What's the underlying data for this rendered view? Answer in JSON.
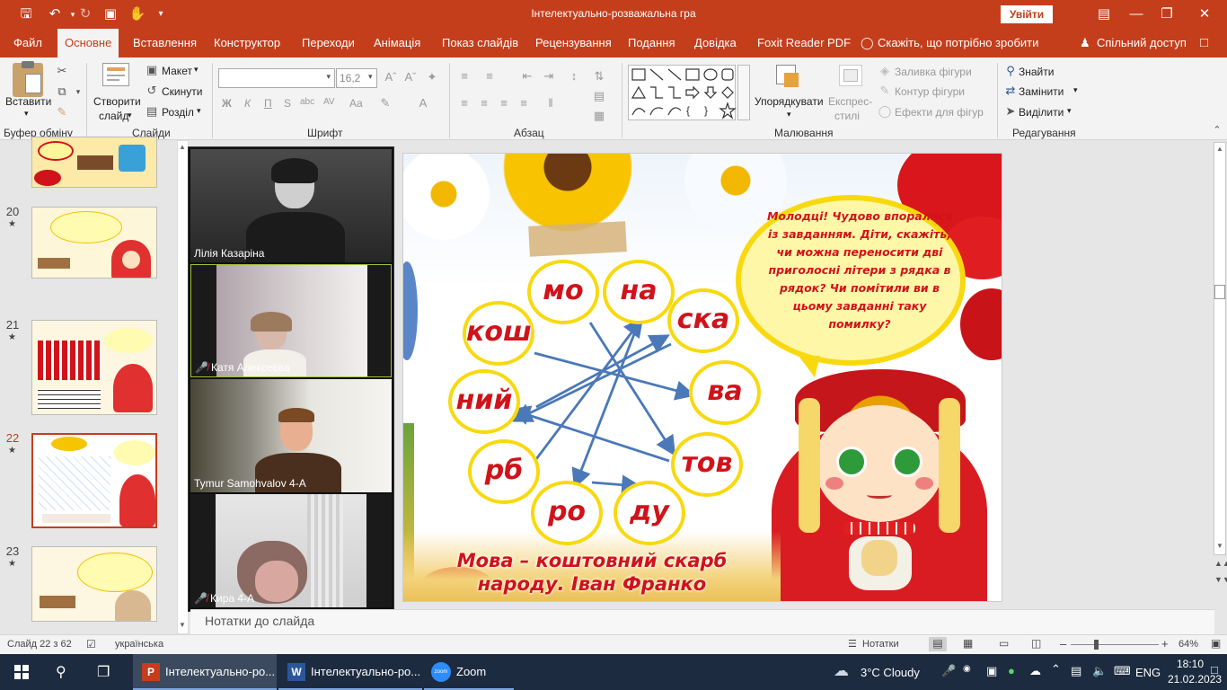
{
  "window": {
    "title": "Інтелектуально-розважальна гра",
    "signin_label": "Увійти"
  },
  "tabs": [
    "Файл",
    "Основне",
    "Вставлення",
    "Конструктор",
    "Переходи",
    "Анімація",
    "Показ слайдів",
    "Рецензування",
    "Подання",
    "Довідка",
    "Foxit Reader PDF"
  ],
  "tellme": "Скажіть, що потрібно зробити",
  "share": "Спільний доступ",
  "ribbon": {
    "paste": "Вставити",
    "clipboard": "Буфер обміну",
    "new_slide_1": "Створити",
    "new_slide_2": "слайд",
    "layout": "Макет",
    "reset": "Скинути",
    "section": "Розділ",
    "slides": "Слайди",
    "font_size": "16,2",
    "bold": "Ж",
    "italic": "К",
    "underline": "П",
    "strike": "S",
    "shadow": "abc",
    "spacing": "AV",
    "case": "Aa",
    "font": "Шрифт",
    "paragraph": "Абзац",
    "arrange": "Упорядкувати",
    "quick_styles_1": "Експрес-",
    "quick_styles_2": "стилі",
    "fill": "Заливка фігури",
    "outline": "Контур фігури",
    "effects": "Ефекти для фігур",
    "drawing": "Малювання",
    "find": "Знайти",
    "replace": "Замінити",
    "select": "Виділити",
    "editing": "Редагування"
  },
  "slides_panel": [
    {
      "num": "20",
      "star": "★"
    },
    {
      "num": "21",
      "star": "★"
    },
    {
      "num": "22",
      "star": "★"
    },
    {
      "num": "23",
      "star": "★"
    }
  ],
  "participants": [
    "Лілія Казаріна",
    "Катя Алексеєва",
    "Tymur Samohvalov 4-А",
    "Кира 4-А"
  ],
  "slide": {
    "syllables": [
      "мо",
      "на",
      "ска",
      "ва",
      "тов",
      "ду",
      "ро",
      "рб",
      "ний",
      "кош"
    ],
    "speech": "Молодці! Чудово впоралися із завданням. Діти, скажіть, чи можна переносити дві приголосні літери з рядка в рядок? Чи помітили ви в цьому завданні таку помилку?",
    "quote_line1": "Мова – коштовний скарб",
    "quote_line2": "народу. Іван Франко"
  },
  "notes_placeholder": "Нотатки до слайда",
  "status": {
    "slide_count": "Слайд 22 з 62",
    "language": "українська",
    "notes": "Нотатки",
    "zoom": "64%"
  },
  "taskbar": {
    "apps": [
      "Інтелектуально-ро...",
      "Інтелектуально-ро...",
      "Zoom"
    ],
    "weather": "3°C  Cloudy",
    "lang": "ENG",
    "time": "18:10",
    "date": "21.02.2023"
  },
  "colors": {
    "ppt_red": "#c43e1c",
    "taskbar": "#1c2b3f",
    "syllable_red": "#d0131a",
    "ring_yellow": "#f8d90f",
    "arrow_blue": "#4a78b8"
  }
}
